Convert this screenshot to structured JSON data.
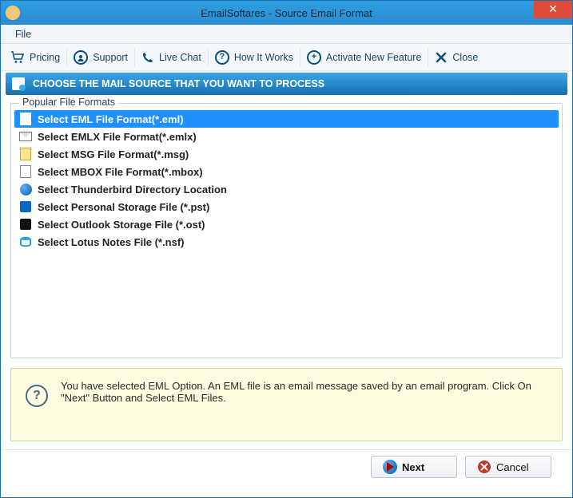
{
  "window": {
    "title": "EmailSoftares - Source Email Format"
  },
  "menubar": {
    "file": "File"
  },
  "toolbar": {
    "pricing": "Pricing",
    "support": "Support",
    "livechat": "Live Chat",
    "howitworks": "How It Works",
    "activate": "Activate New Feature",
    "close": "Close"
  },
  "banner": {
    "text": "CHOOSE THE MAIL SOURCE THAT YOU WANT TO PROCESS"
  },
  "groupbox": {
    "title": "Popular File Formats"
  },
  "formats": {
    "eml": "Select EML File Format(*.eml)",
    "emlx": "Select EMLX File Format(*.emlx)",
    "msg": "Select MSG File Format(*.msg)",
    "mbox": "Select MBOX File Format(*.mbox)",
    "tbird": "Select Thunderbird Directory Location",
    "pst": "Select Personal Storage File (*.pst)",
    "ost": "Select Outlook Storage File (*.ost)",
    "nsf": "Select Lotus Notes File (*.nsf)"
  },
  "info": {
    "text": "You have selected EML Option. An EML file is an email message saved by an email program. Click On \"Next\" Button and Select EML Files."
  },
  "buttons": {
    "next": "Next",
    "cancel": "Cancel"
  }
}
